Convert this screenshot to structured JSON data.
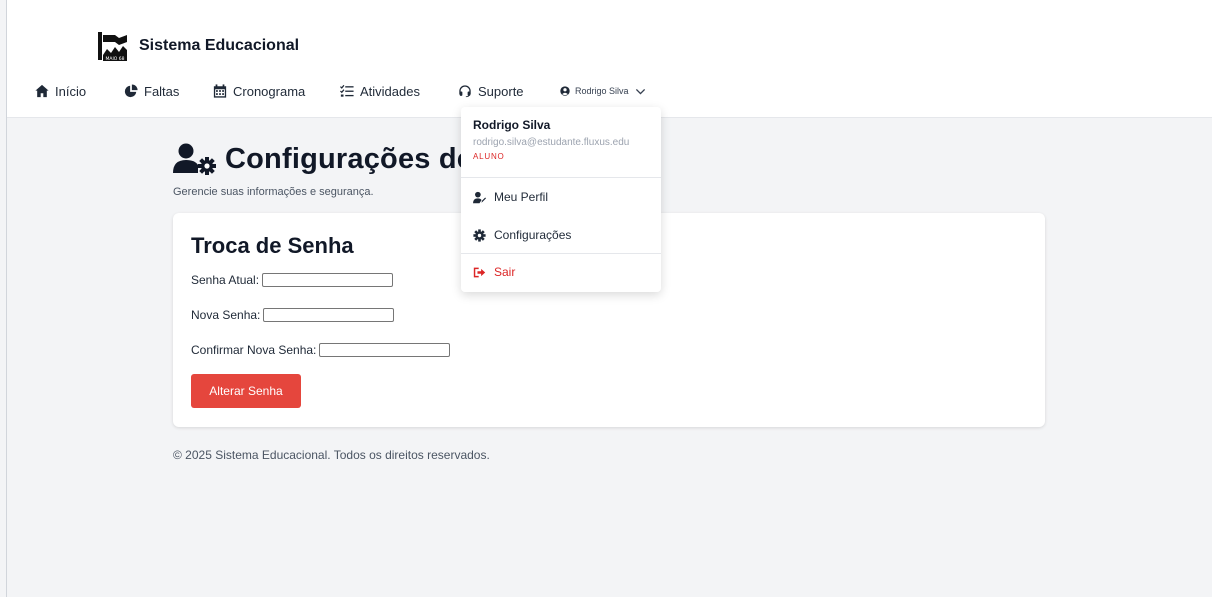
{
  "brand": {
    "name": "Sistema Educacional",
    "logo_text": "MAIO 68"
  },
  "nav": {
    "items": [
      {
        "label": "Início",
        "icon": "home-icon"
      },
      {
        "label": "Faltas",
        "icon": "pie-chart-icon"
      },
      {
        "label": "Cronograma",
        "icon": "calendar-icon"
      },
      {
        "label": "Atividades",
        "icon": "list-check-icon"
      },
      {
        "label": "Suporte",
        "icon": "headset-icon"
      }
    ],
    "user": {
      "label": "Rodrigo Silva",
      "icon": "user-circle-icon",
      "chevron": "chevron-down-icon"
    }
  },
  "page": {
    "title": "Configurações de Usuário",
    "subtitle": "Gerencie suas informações e segurança."
  },
  "password_card": {
    "title": "Troca de Senha",
    "current_label": "Senha Atual:",
    "current_value": "",
    "new_label": "Nova Senha:",
    "new_value": "",
    "confirm_label": "Confirmar Nova Senha:",
    "confirm_value": "",
    "submit_label": "Alterar Senha"
  },
  "footer": {
    "text": "© 2025 Sistema Educacional. Todos os direitos reservados."
  },
  "user_menu": {
    "name": "Rodrigo Silva",
    "email": "rodrigo.silva@estudante.fluxus.edu",
    "role": "ALUNO",
    "items": [
      {
        "label": "Meu Perfil",
        "icon": "user-edit-icon"
      },
      {
        "label": "Configurações",
        "icon": "gear-icon"
      },
      {
        "label": "Sair",
        "icon": "sign-out-icon"
      }
    ]
  },
  "colors": {
    "primary": "#e5463d",
    "danger": "#dc2626",
    "background": "#f3f4f6"
  }
}
